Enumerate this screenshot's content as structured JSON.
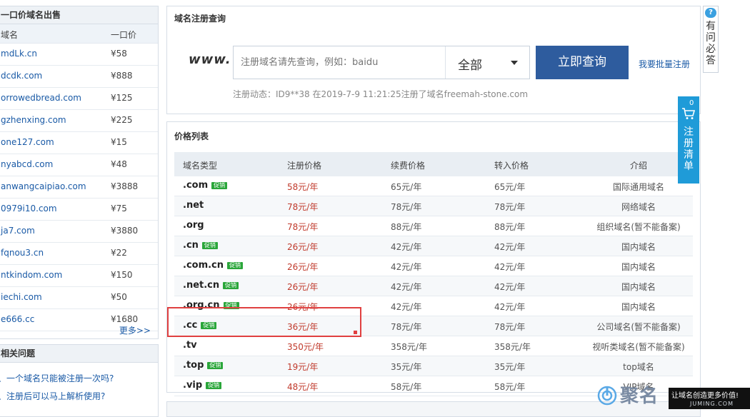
{
  "left_panel": {
    "title": "一口价域名出售",
    "col_domain": "域名",
    "col_price": "一口价",
    "rows": [
      {
        "name": "mdLk.cn",
        "price": "¥58"
      },
      {
        "name": "dcdk.com",
        "price": "¥888"
      },
      {
        "name": "orrowedbread.com",
        "price": "¥125"
      },
      {
        "name": "gzhenxing.com",
        "price": "¥225"
      },
      {
        "name": "one127.com",
        "price": "¥15"
      },
      {
        "name": "nyabcd.com",
        "price": "¥48"
      },
      {
        "name": "anwangcaipiao.com",
        "price": "¥3888"
      },
      {
        "name": "0979i10.com",
        "price": "¥75"
      },
      {
        "name": "ja7.com",
        "price": "¥3880"
      },
      {
        "name": "fqnou3.cn",
        "price": "¥22"
      },
      {
        "name": "ntkindom.com",
        "price": "¥150"
      },
      {
        "name": "iechi.com",
        "price": "¥50"
      },
      {
        "name": "e666.cc",
        "price": "¥1680"
      }
    ],
    "more": "更多>>"
  },
  "faq_panel": {
    "title": "相关问题",
    "items": [
      "、一个域名只能被注册一次吗?",
      "、注册后可以马上解析使用?"
    ]
  },
  "query_panel": {
    "title": "域名注册查询",
    "www": "www.",
    "placeholder": "注册域名请先查询，例如：baidu",
    "select_value": "全部",
    "button": "立即查询",
    "bulk_link": "我要批量注册",
    "reg_news": "注册动态：ID9**38 在2019-7-9 11:21:25注册了域名freemah-stone.com"
  },
  "price_panel": {
    "title": "价格列表",
    "headers": [
      "域名类型",
      "注册价格",
      "续费价格",
      "转入价格",
      "介绍"
    ],
    "promo_tag": "促销",
    "rows": [
      {
        "type": ".com",
        "promo": true,
        "reg": "58元/年",
        "renew": "65元/年",
        "transfer": "65元/年",
        "intro": "国际通用域名"
      },
      {
        "type": ".net",
        "promo": false,
        "reg": "78元/年",
        "renew": "78元/年",
        "transfer": "78元/年",
        "intro": "网络域名"
      },
      {
        "type": ".org",
        "promo": false,
        "reg": "78元/年",
        "renew": "88元/年",
        "transfer": "88元/年",
        "intro": "组织域名(暂不能备案)"
      },
      {
        "type": ".cn",
        "promo": true,
        "reg": "26元/年",
        "renew": "42元/年",
        "transfer": "42元/年",
        "intro": "国内域名"
      },
      {
        "type": ".com.cn",
        "promo": true,
        "reg": "26元/年",
        "renew": "42元/年",
        "transfer": "42元/年",
        "intro": "国内域名"
      },
      {
        "type": ".net.cn",
        "promo": true,
        "reg": "26元/年",
        "renew": "42元/年",
        "transfer": "42元/年",
        "intro": "国内域名"
      },
      {
        "type": ".org.cn",
        "promo": true,
        "reg": "26元/年",
        "renew": "42元/年",
        "transfer": "42元/年",
        "intro": "国内域名"
      },
      {
        "type": ".cc",
        "promo": true,
        "reg": "36元/年",
        "renew": "78元/年",
        "transfer": "78元/年",
        "intro": "公司域名(暂不能备案)"
      },
      {
        "type": ".tv",
        "promo": false,
        "reg": "350元/年",
        "renew": "358元/年",
        "transfer": "358元/年",
        "intro": "视听类域名(暂不能备案)"
      },
      {
        "type": ".top",
        "promo": true,
        "reg": "19元/年",
        "renew": "35元/年",
        "transfer": "35元/年",
        "intro": "top域名"
      },
      {
        "type": ".vip",
        "promo": true,
        "reg": "48元/年",
        "renew": "58元/年",
        "transfer": "58元/年",
        "intro": "VIP域名"
      }
    ]
  },
  "faq_float": {
    "bubble": "?",
    "text": "有问必答"
  },
  "cart_float": {
    "count": "0",
    "text": "注册清单"
  },
  "watermark": {
    "title": "聚名",
    "slogan": "让域名创造更多价值!",
    "domain": "JUMING.COM"
  }
}
